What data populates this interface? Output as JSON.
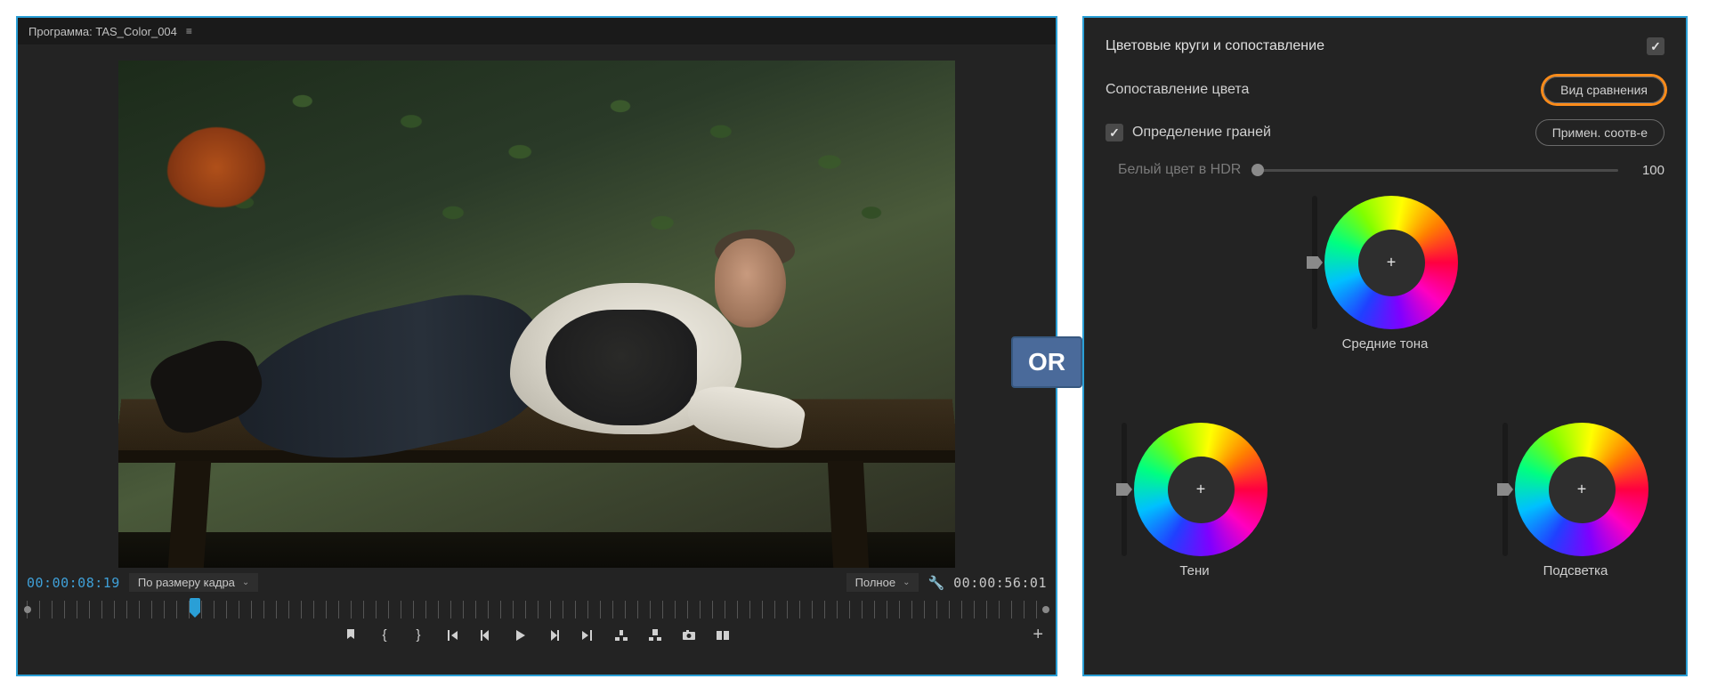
{
  "program": {
    "header_prefix": "Программа:",
    "sequence_name": "TAS_Color_004",
    "timecode_current": "00:00:08:19",
    "fit_dropdown": "По размеру кадра",
    "quality_dropdown": "Полное",
    "timecode_duration": "00:00:56:01"
  },
  "or_badge": "OR",
  "color": {
    "section_title": "Цветовые круги и сопоставление",
    "match_label": "Сопоставление цвета",
    "comparison_button": "Вид сравнения",
    "face_detect_label": "Определение граней",
    "apply_button": "Примен. соотв-е",
    "hdr_white_label": "Белый цвет в HDR",
    "hdr_white_value": "100",
    "wheel_mid": "Средние тона",
    "wheel_shadows": "Тени",
    "wheel_highlights": "Подсветка"
  }
}
